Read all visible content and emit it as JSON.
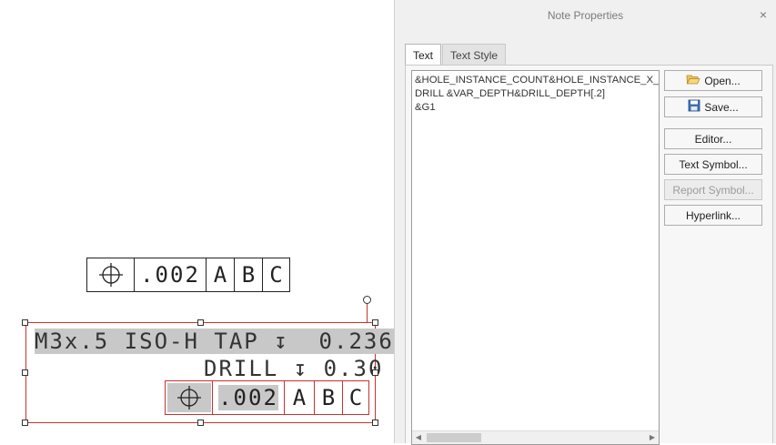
{
  "drawing": {
    "fcf_top": {
      "symbol": "⌖",
      "tolerance": ".002",
      "datums": [
        "A",
        "B",
        "C"
      ]
    },
    "note": {
      "line1_left": "M3x.5 ISO-H",
      "line1_rest": " TAP ↧  0.236",
      "line2": "DRILL ↧ 0.30",
      "fcf": {
        "symbol": "⌖",
        "tolerance": ".002",
        "datums": [
          "A",
          "B",
          "C"
        ]
      }
    },
    "selection_color": "#c8322f"
  },
  "dialog": {
    "title": "Note Properties",
    "close_glyph": "×",
    "tabs": [
      "Text",
      "Text Style"
    ],
    "text_lines": [
      "&HOLE_INSTANCE_COUNT&HOLE_INSTANCE_X_S",
      "DRILL &VAR_DEPTH&DRILL_DEPTH[.2]",
      "&G1"
    ],
    "buttons": {
      "open": "Open...",
      "save": "Save...",
      "editor": "Editor...",
      "text_symbol": "Text Symbol...",
      "report_symbol": "Report Symbol...",
      "hyperlink": "Hyperlink..."
    },
    "icons": {
      "open": "folder-open-icon",
      "save": "floppy-disk-icon"
    }
  }
}
